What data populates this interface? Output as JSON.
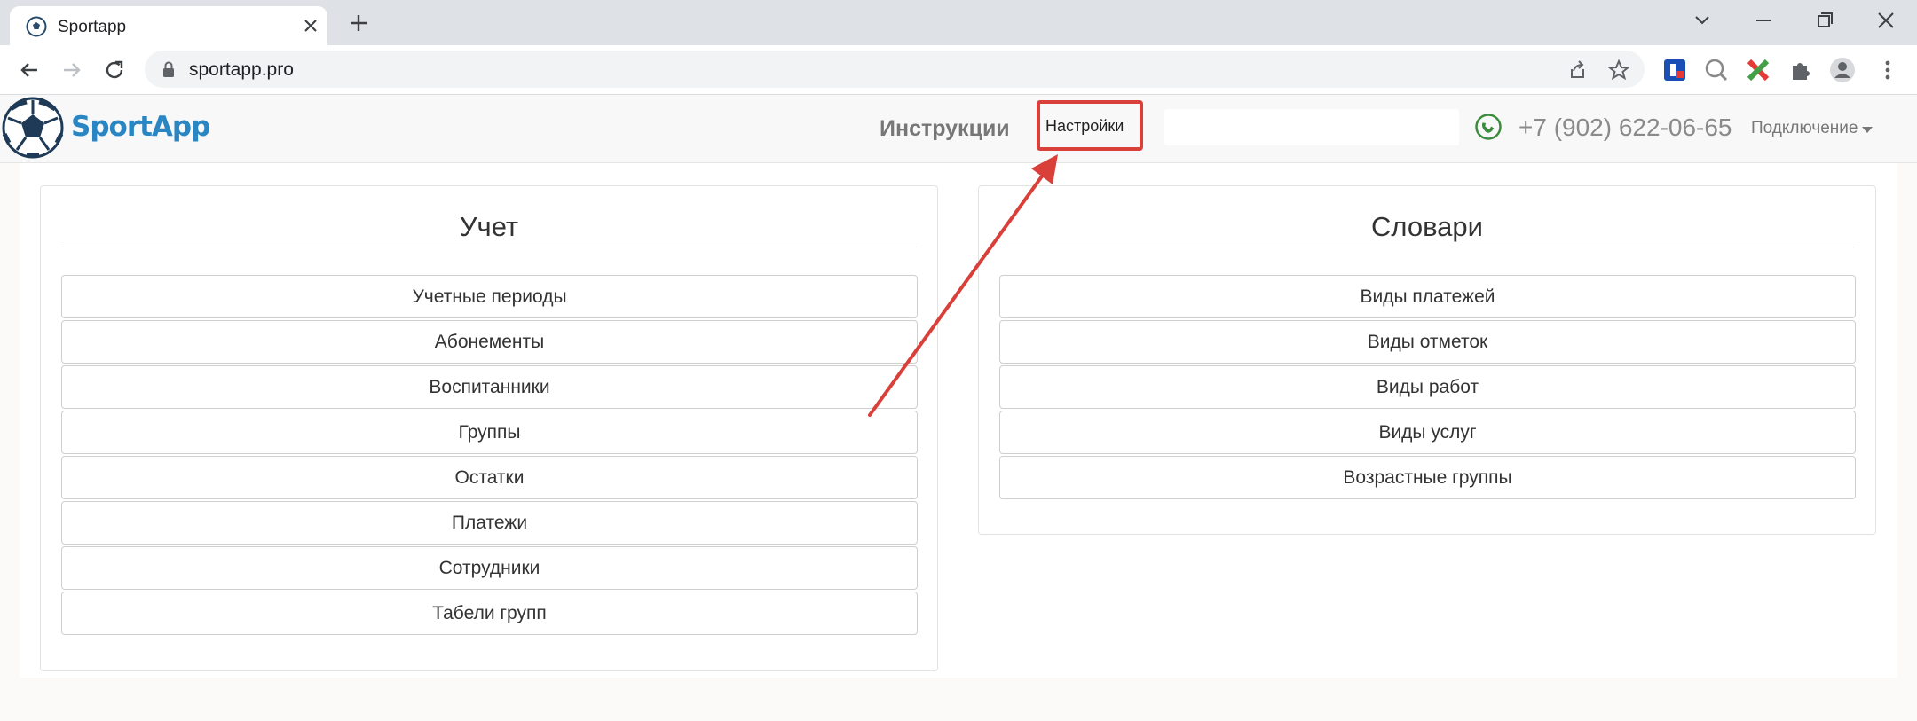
{
  "browser": {
    "tab_title": "Sportapp",
    "url": "sportapp.pro"
  },
  "header": {
    "brand": "SportApp",
    "nav_instructions": "Инструкции",
    "nav_settings": "Настройки",
    "phone": "+7 (902) 622-06-65",
    "connect": "Подключение"
  },
  "left_panel": {
    "title": "Учет",
    "items": [
      "Учетные периоды",
      "Абонементы",
      "Воспитанники",
      "Группы",
      "Остатки",
      "Платежи",
      "Сотрудники",
      "Табели групп"
    ]
  },
  "right_panel": {
    "title": "Словари",
    "items": [
      "Виды платежей",
      "Виды отметок",
      "Виды работ",
      "Виды услуг",
      "Возрастные группы"
    ]
  },
  "annotation": {
    "color": "#d9403a"
  }
}
